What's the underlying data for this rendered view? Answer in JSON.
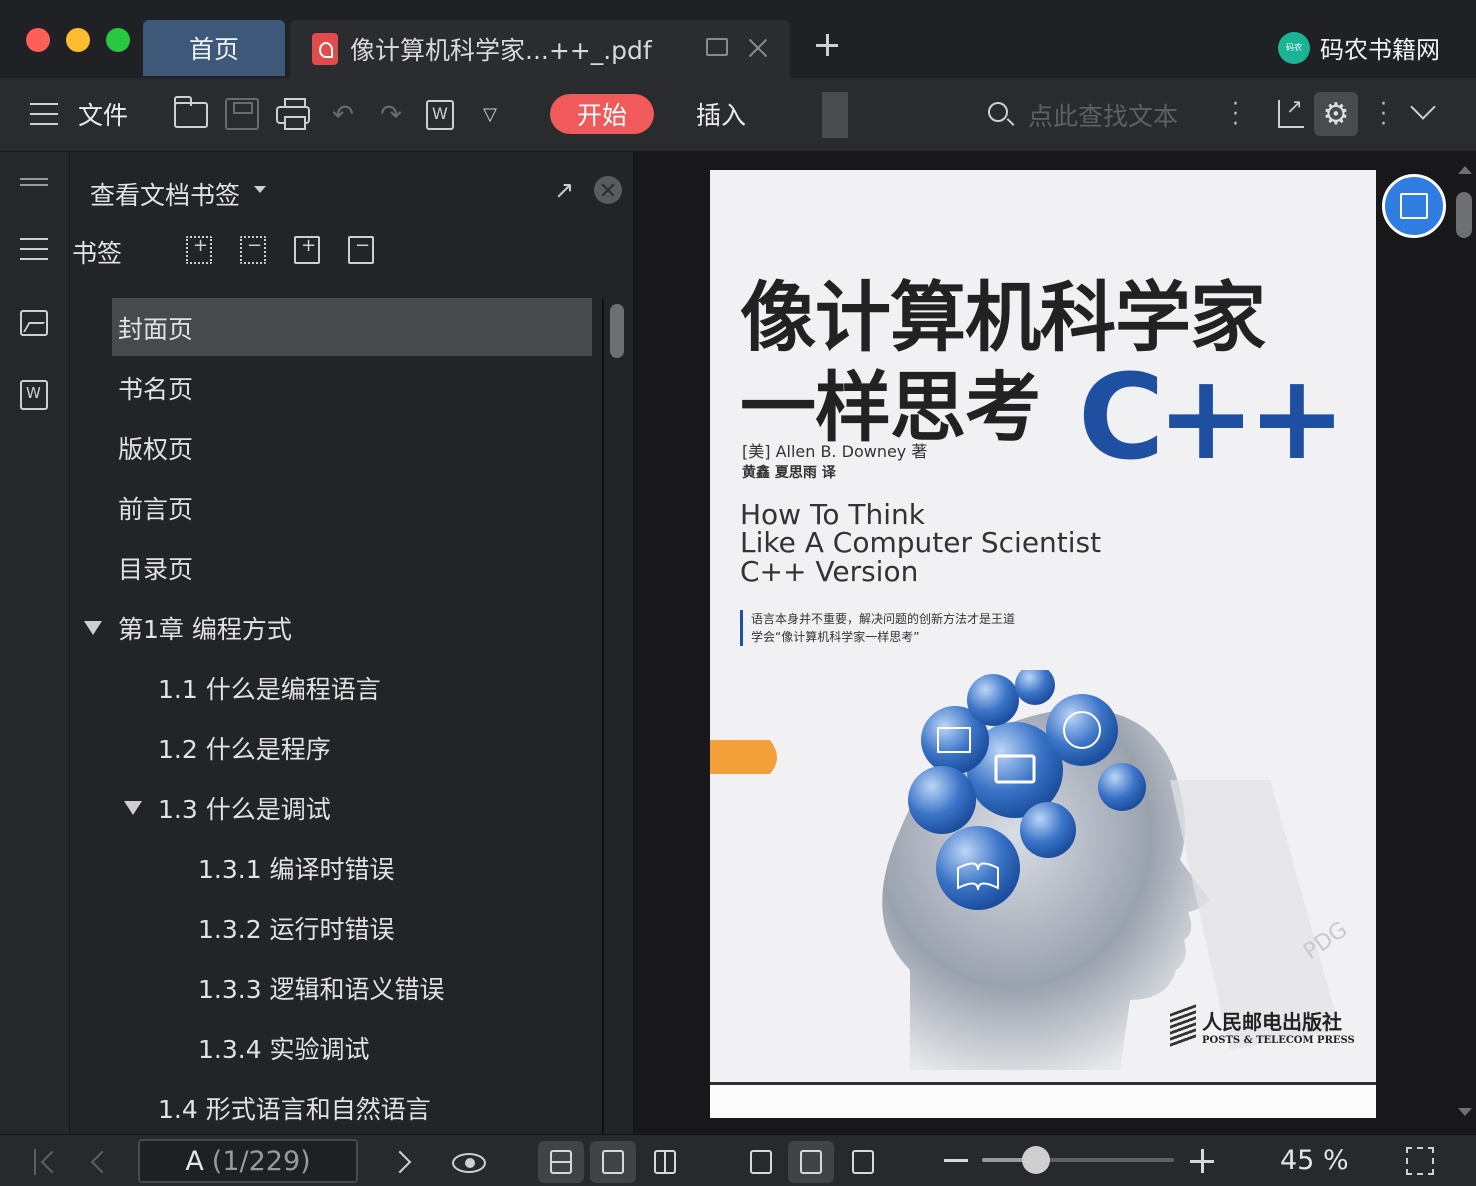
{
  "window": {
    "tabs": [
      {
        "label": "首页",
        "active": false
      },
      {
        "label": "像计算机科学家...++_.pdf",
        "active": true
      }
    ],
    "brand": {
      "logo_text": "码农",
      "name": "码农书籍网"
    }
  },
  "toolbar": {
    "file_label": "文件",
    "start_label": "开始",
    "insert_label": "插入",
    "search_placeholder": "点此查找文本",
    "icons": [
      "menu-icon",
      "open-folder-icon",
      "save-icon",
      "print-icon",
      "undo-icon",
      "redo-icon",
      "sign-icon",
      "more-dropdown-icon",
      "search-icon",
      "share-icon",
      "settings-icon",
      "chevron-down-icon"
    ],
    "accent_color": "#f05a5a"
  },
  "sidebar": {
    "panel_title": "查看文档书签",
    "bookmark_label": "书签",
    "items": [
      {
        "label": "封面页",
        "level": 0,
        "selected": true
      },
      {
        "label": "书名页",
        "level": 0
      },
      {
        "label": "版权页",
        "level": 0
      },
      {
        "label": "前言页",
        "level": 0
      },
      {
        "label": "目录页",
        "level": 0
      },
      {
        "label": "第1章 编程方式",
        "level": 0,
        "expanded": true
      },
      {
        "label": "1.1 什么是编程语言",
        "level": 1
      },
      {
        "label": "1.2 什么是程序",
        "level": 1
      },
      {
        "label": "1.3 什么是调试",
        "level": 1,
        "expanded": true
      },
      {
        "label": "1.3.1 编译时错误",
        "level": 2
      },
      {
        "label": "1.3.2 运行时错误",
        "level": 2
      },
      {
        "label": "1.3.3 逻辑和语义错误",
        "level": 2
      },
      {
        "label": "1.3.4 实验调试",
        "level": 2
      },
      {
        "label": "1.4 形式语言和自然语言",
        "level": 1
      }
    ]
  },
  "document": {
    "cover": {
      "title_line1": "像计算机科学家",
      "title_line2": "一样思考",
      "title_cpp": "C++",
      "author": "[美] Allen B. Downey 著",
      "translators": "黄鑫 夏思雨 译",
      "english_title": [
        "How To Think",
        "Like A Computer Scientist",
        "C++ Version"
      ],
      "slogan": [
        "语言本身并不重要，解决问题的创新方法才是王道",
        "学会“像计算机科学家一样思考”"
      ],
      "publisher_cn": "人民邮电出版社",
      "publisher_en": "POSTS & TELECOM PRESS",
      "watermark": "PDG",
      "title_color": "#1e4fa0"
    }
  },
  "statusbar": {
    "page_label": "A",
    "page_position": "(1/229)",
    "zoom_label": "45 %",
    "zoom_fraction": 0.28
  }
}
